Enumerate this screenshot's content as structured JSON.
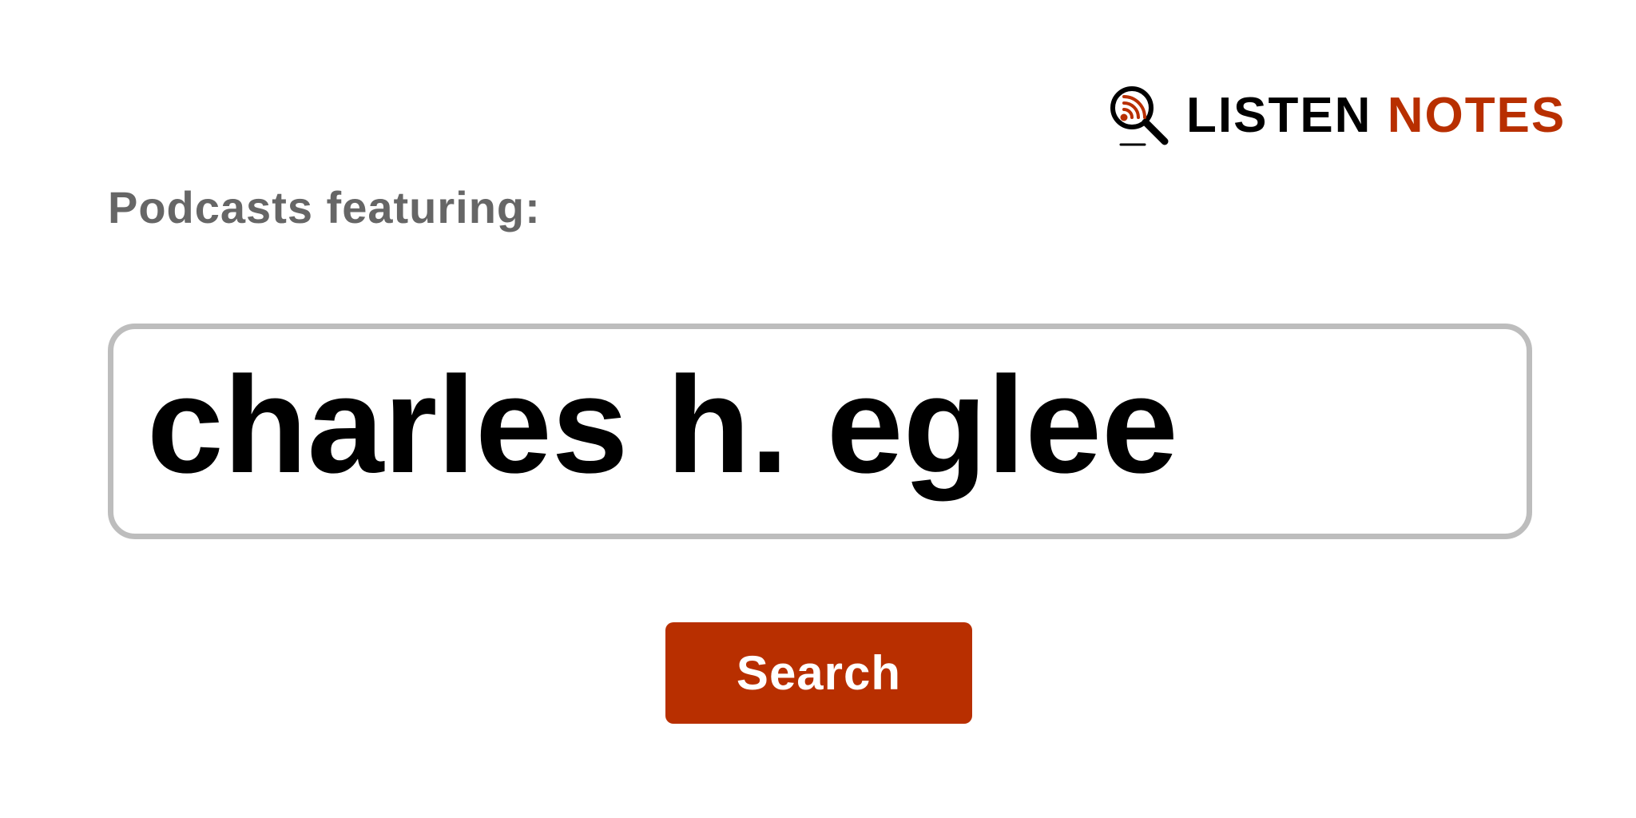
{
  "logo": {
    "word1": "LISTEN",
    "word2": "NOTES",
    "icon": "podcast-search-icon"
  },
  "heading": "Podcasts featuring:",
  "search": {
    "query": "charles h. eglee"
  },
  "button": {
    "label": "Search"
  },
  "colors": {
    "accent": "#b82f00",
    "heading_text": "#666666",
    "input_border": "#bdbdbd"
  }
}
